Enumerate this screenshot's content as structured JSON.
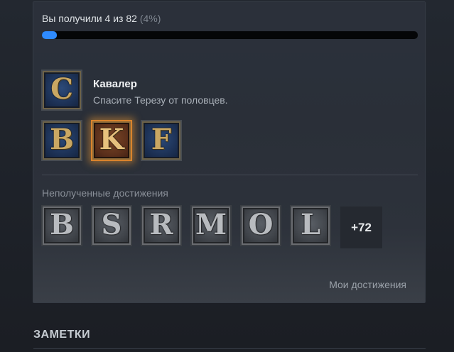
{
  "progress": {
    "prefix": "Вы получили ",
    "earned": 4,
    "of_word": " из ",
    "total": 82,
    "percent_text": "(4%)",
    "fraction": 0.04,
    "accent_color": "#2f8bff"
  },
  "featured": {
    "icon_letter": "C",
    "title": "Кавалер",
    "description": "Спасите Терезу от половцев."
  },
  "earned_icons": [
    {
      "letter": "B",
      "featured": false
    },
    {
      "letter": "K",
      "featured": true
    },
    {
      "letter": "F",
      "featured": false
    }
  ],
  "locked": {
    "title": "Неполученные достижения",
    "icons": [
      "B",
      "S",
      "R",
      "M",
      "O",
      "L"
    ],
    "more_label": "+72"
  },
  "my_achievements_link": "Мои достижения",
  "notes_header": "ЗАМЕТКИ"
}
